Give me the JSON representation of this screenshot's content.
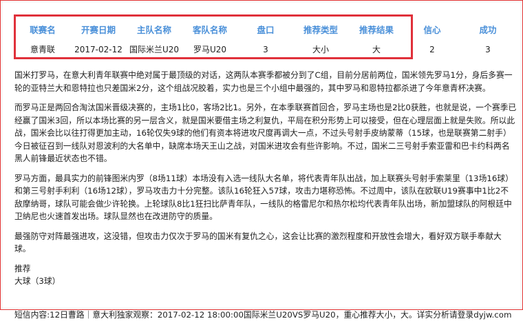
{
  "match_table": {
    "headers": [
      "联赛名",
      "开赛日期",
      "主队名称",
      "客队名称",
      "盘口",
      "推荐类型",
      "推荐结果",
      "信心",
      "成功"
    ],
    "row": [
      "意青联",
      "2017-02-12",
      "国际米兰U20",
      "罗马U20",
      "3",
      "大小",
      "大",
      "2",
      "3"
    ]
  },
  "article": {
    "paragraphs": [
      "国米打罗马，在意大利青年联赛中绝对属于最顶级的对话，这两队本赛季都被分到了C组，目前分居前两位，国米领先罗马1分，身后多赛一\n轮的亚特兰大和恩特拉也只差国米2分，这个组战况胶着，实力也是三个小组中最强的，其中罗马和恩特拉都杀进了今年意青杯决赛。",
      "而罗马正是两回合淘汰国米晋级决赛的，主场1比0，客场2比1。另外，在本季联赛首回合，罗马主场也是2比0获胜，也就是说，一个赛季已\n经赢了国米3回，所以本场比赛的另一层含义，就是国米要借主场之利复仇，平局在积分形势上可以接受，但在心理层面上就是失败。所以此\n战，国米会比以往打得更加主动，16轮仅失9球的他们有资本将进攻尺度再调大一点，不过头号射手皮纳蒙蒂（15球，也是联赛第二射手）\n今日被征召到一线队对恩波利的大名单中，缺席本场天王山之战，对国米进攻会有些许影响。不过，国米二三号射手索亚雷和巴卡约科两名\n黑人前锋最近状态也不错。",
      "罗马方面，最具实力的前锋图米内罗（8场11球）本场没有入选一线队大名单，将代表青年队出战，加上联赛头号射手索莱里（13场16球）\n和第三号射手利利（16场12球），罗马攻击力十分完整。该队16轮狂入57球，攻击力堪称恐怖。不过周中，该队在欧联U19赛事中1比2不\n敌摩纳哥，球队可能会做少许轮换。上轮球队8比1狂扫比萨青年队，一线队的格雷尼尔和热尔松均代表青年队出场，新加盟球队的阿根廷中\n卫纳尼也火速首发出场。球队显然也在改进防守的质量。",
      "最强防守对阵最强进攻，这没错，但攻击力仅次于罗马的国米有复仇之心，这会让比赛的激烈程度和开放性会增大，看好双方联手奉献大\n球。"
    ],
    "recommend_title": "推荐",
    "recommend_value": "大球（3球）",
    "sms": "短信内容:12日曹路｜意大利独家观察：2017-02-12 18:00:00国际米兰U20VS罗马U20，重心推荐大小，大。详实分析请登录dyjw.com"
  },
  "colors": {
    "header_text": "#4a90d9",
    "highlight_border": "#e0303a",
    "page_border": "#e03030"
  }
}
